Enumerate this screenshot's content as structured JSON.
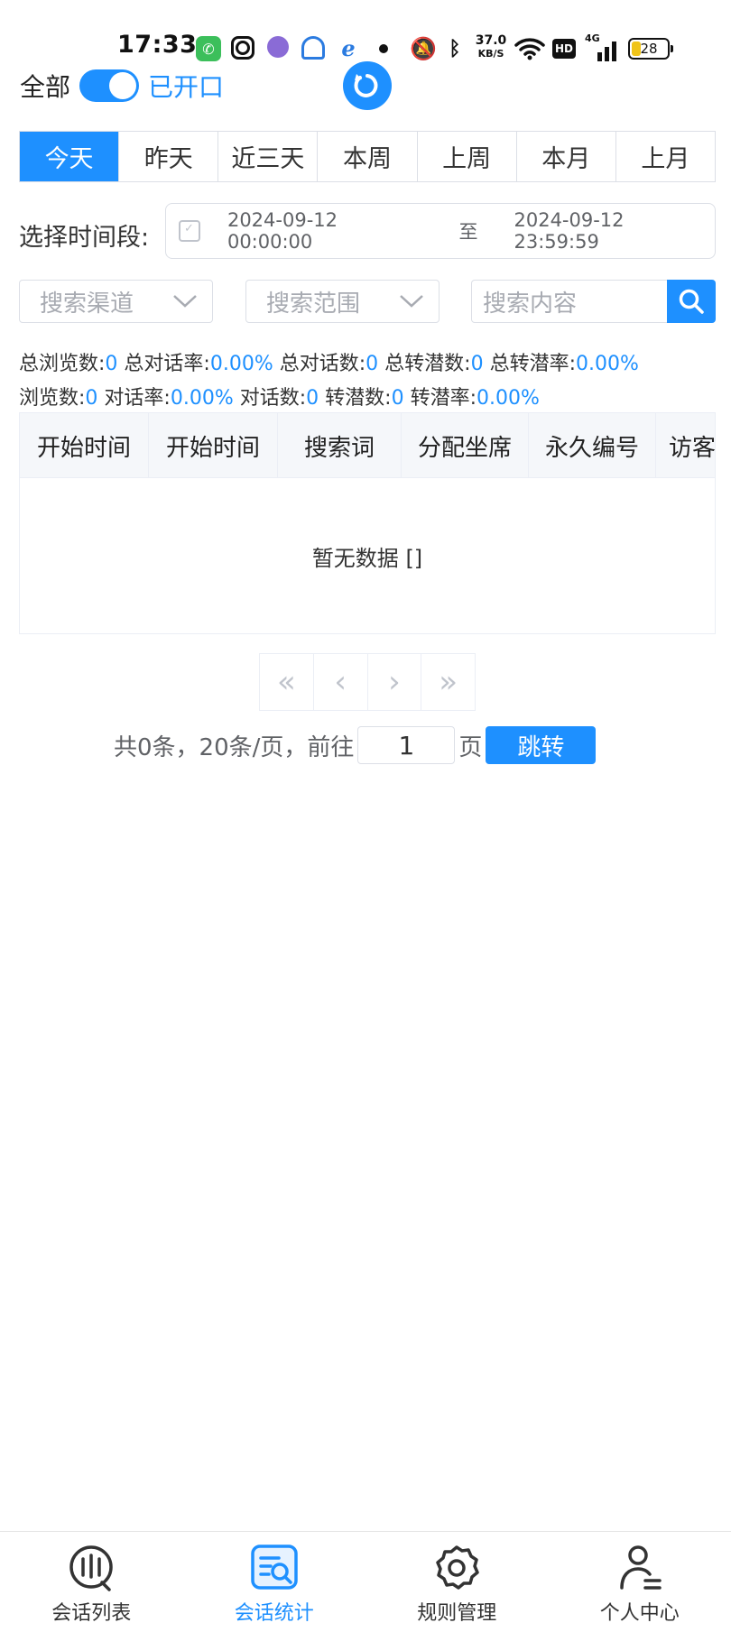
{
  "status_bar": {
    "time": "17:33",
    "net_speed_value": "37.0",
    "net_speed_unit": "KB/S",
    "hd_badge": "HD",
    "network_type": "4G",
    "battery": "28"
  },
  "filter": {
    "all_label": "全部",
    "toggle_state_label": "已开口"
  },
  "tabs": [
    {
      "label": "今天",
      "active": true
    },
    {
      "label": "昨天"
    },
    {
      "label": "近三天"
    },
    {
      "label": "本周"
    },
    {
      "label": "上周"
    },
    {
      "label": "本月"
    },
    {
      "label": "上月"
    }
  ],
  "date_range": {
    "label": "选择时间段:",
    "start": "2024-09-12 00:00:00",
    "separator": "至",
    "end": "2024-09-12 23:59:59"
  },
  "search": {
    "channel_placeholder": "搜索渠道",
    "scope_placeholder": "搜索范围",
    "content_placeholder": "搜索内容"
  },
  "stats_total": {
    "views_label": "总浏览数:",
    "views": "0",
    "chat_rate_label": "总对话率:",
    "chat_rate": "0.00%",
    "chats_label": "总对话数:",
    "chats": "0",
    "conversions_label": "总转潜数:",
    "conversions": "0",
    "conversion_rate_label": "总转潜率:",
    "conversion_rate": "0.00%"
  },
  "stats": {
    "views_label": "浏览数:",
    "views": "0",
    "chat_rate_label": "对话率:",
    "chat_rate": "0.00%",
    "chats_label": "对话数:",
    "chats": "0",
    "conversions_label": "转潜数:",
    "conversions": "0",
    "conversion_rate_label": "转潜率:",
    "conversion_rate": "0.00%"
  },
  "table": {
    "columns": [
      "开始时间",
      "开始时间",
      "搜索词",
      "分配坐席",
      "永久编号",
      "访客"
    ],
    "empty_text": "暂无数据 []"
  },
  "pager": {
    "total_text": "共0条，20条/页，前往",
    "page_value": "1",
    "page_suffix": "页",
    "jump_label": "跳转"
  },
  "bottom_nav": [
    {
      "label": "会话列表",
      "icon": "chat-list-icon"
    },
    {
      "label": "会话统计",
      "icon": "chat-stats-icon",
      "active": true
    },
    {
      "label": "规则管理",
      "icon": "gear-icon"
    },
    {
      "label": "个人中心",
      "icon": "user-icon"
    }
  ],
  "colors": {
    "accent": "#1e90ff",
    "border": "#dcdfe6",
    "placeholder": "#a8abb2"
  }
}
